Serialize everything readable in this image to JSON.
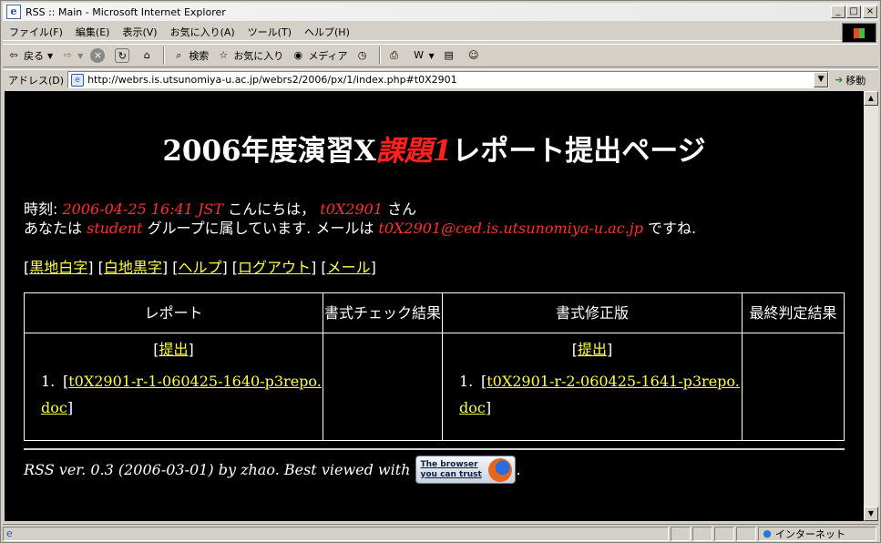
{
  "window": {
    "title": "RSS :: Main - Microsoft Internet Explorer"
  },
  "menu": [
    "ファイル(F)",
    "編集(E)",
    "表示(V)",
    "お気に入り(A)",
    "ツール(T)",
    "ヘルプ(H)"
  ],
  "toolbar": {
    "back": "戻る",
    "search": "検索",
    "favorites": "お気に入り",
    "media": "メディア"
  },
  "address": {
    "label": "アドレス(D)",
    "url": "http://webrs.is.utsunomiya-u.ac.jp/webrs2/2006/px/1/index.php#t0X2901",
    "go": "移動"
  },
  "page": {
    "title_pre": "2006年度演習X",
    "title_em": "課題1",
    "title_post": "レポート提出ページ",
    "line1": {
      "pre": "時刻:",
      "time": "2006-04-25 16:41 JST",
      "mid": "こんにちは，",
      "user": "t0X2901",
      "post": "さん"
    },
    "line2": {
      "pre": "あなたは",
      "group": "student",
      "mid": "グループに属しています. メールは",
      "mail": "t0X2901@ced.is.utsunomiya-u.ac.jp",
      "post": "ですね."
    },
    "links": [
      "黒地白字",
      "白地黒字",
      "ヘルプ",
      "ログアウト",
      "メール"
    ],
    "table": {
      "headers": [
        "レポート",
        "書式チェック結果",
        "書式修正版",
        "最終判定結果"
      ],
      "submit": "提出",
      "report_num": "1.",
      "report_file": "t0X2901-r-1-060425-1640-p3repo.doc",
      "fixed_num": "1.",
      "fixed_file": "t0X2901-r-2-060425-1641-p3repo.doc"
    },
    "footer": {
      "text": "RSS ver. 0.3 (2006-03-01) by zhao. Best viewed with",
      "badge1": "The browser",
      "badge2": "you can trust",
      "end": "."
    }
  },
  "status": {
    "zone": "インターネット"
  }
}
